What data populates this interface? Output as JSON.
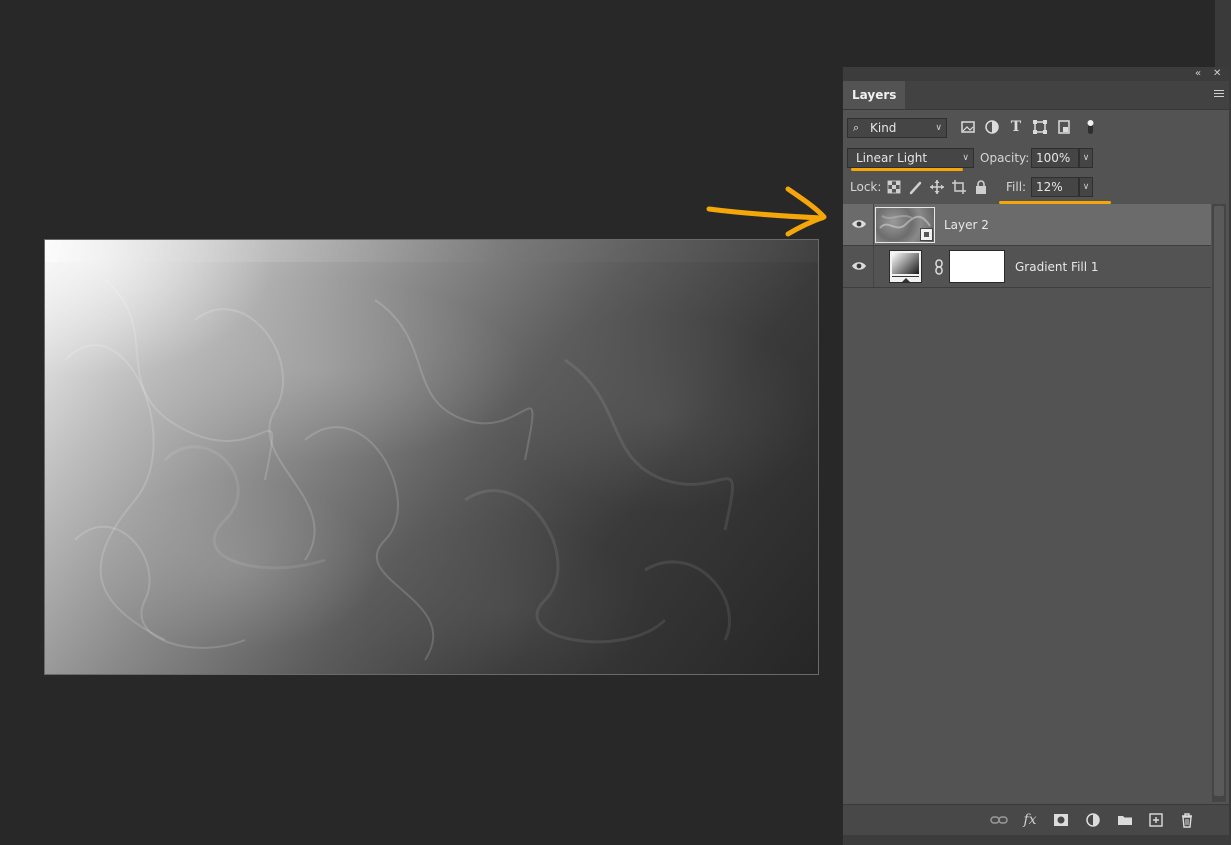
{
  "panel": {
    "tab_label": "Layers",
    "collapse_glyph": "«",
    "close_glyph": "✕"
  },
  "filter": {
    "kind_label": "Kind",
    "icons": [
      "pixel-layer-filter-icon",
      "adjustment-layer-filter-icon",
      "type-layer-filter-icon",
      "shape-layer-filter-icon",
      "smart-object-filter-icon",
      "filter-toggle-icon"
    ]
  },
  "blend": {
    "mode": "Linear Light",
    "opacity_label": "Opacity:",
    "opacity_value": "100%"
  },
  "lock": {
    "label": "Lock:",
    "icons": [
      "lock-transparent-pixels-icon",
      "lock-image-pixels-icon",
      "lock-position-icon",
      "lock-artboard-icon",
      "lock-all-icon"
    ],
    "fill_label": "Fill:",
    "fill_value": "12%"
  },
  "layers": [
    {
      "name": "Layer 2",
      "selected": true,
      "visible": true,
      "type": "smart-object"
    },
    {
      "name": "Gradient Fill 1",
      "selected": false,
      "visible": true,
      "type": "gradient-fill"
    }
  ],
  "bottom_icons": [
    "link-layers-icon",
    "layer-style-fx-icon",
    "add-mask-icon",
    "new-adjustment-layer-icon",
    "new-group-icon",
    "new-layer-icon",
    "delete-layer-icon"
  ],
  "bottom_fx_label": "fx",
  "colors": {
    "annotation": "#f5a70a",
    "panel_bg": "#535353",
    "app_bg": "#282828",
    "selected_row": "#6b6b6b"
  }
}
